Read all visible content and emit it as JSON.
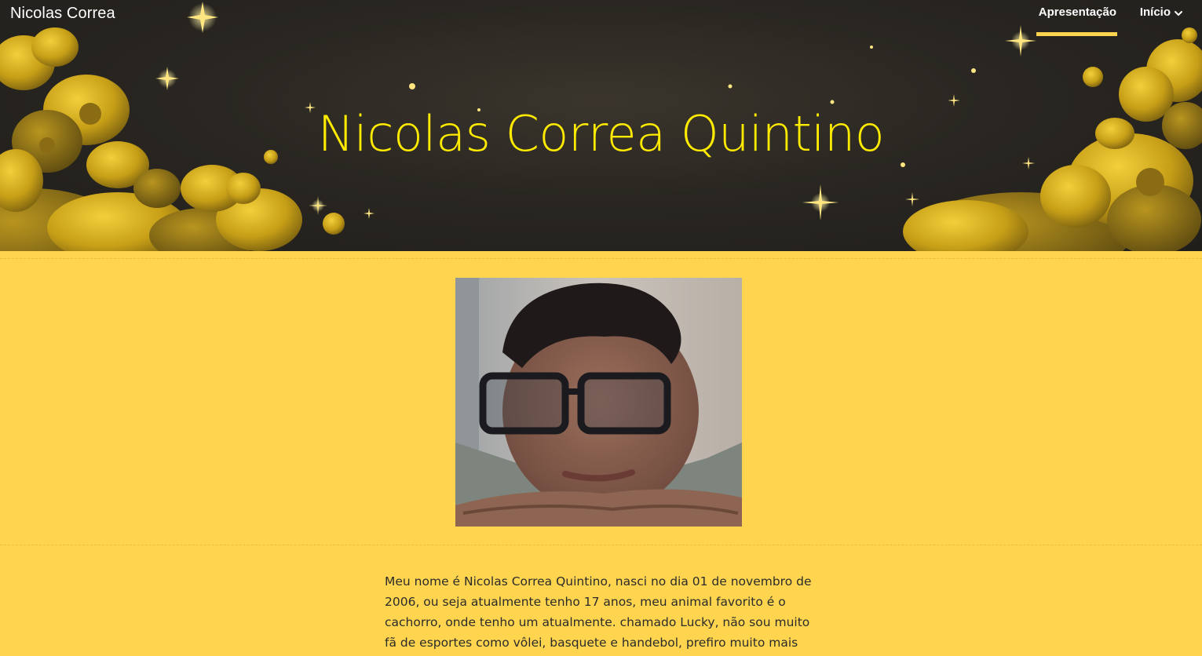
{
  "header": {
    "site_title": "Nicolas Correa",
    "nav": [
      {
        "label": "Apresentação",
        "active": true
      },
      {
        "label": "Início",
        "has_dropdown": true
      }
    ],
    "icon": "chevron-down-icon"
  },
  "hero": {
    "heading": "Nicolas Correa Quintino"
  },
  "profile": {
    "photo": "profile-photo"
  },
  "bio": {
    "text": "Meu nome é Nicolas Correa Quintino, nasci no dia 01 de novembro de 2006, ou seja atualmente tenho 17 anos, meu animal favorito é o cachorro, onde tenho um atualmente. chamado Lucky, não sou muito fã de esportes como vôlei, basquete e handebol, prefiro muito mais"
  },
  "colors": {
    "accent": "#ffd54f",
    "hero_title": "#ffeb00",
    "hero_bg": "#2a2722",
    "flower_gold": "#c9a21c"
  }
}
